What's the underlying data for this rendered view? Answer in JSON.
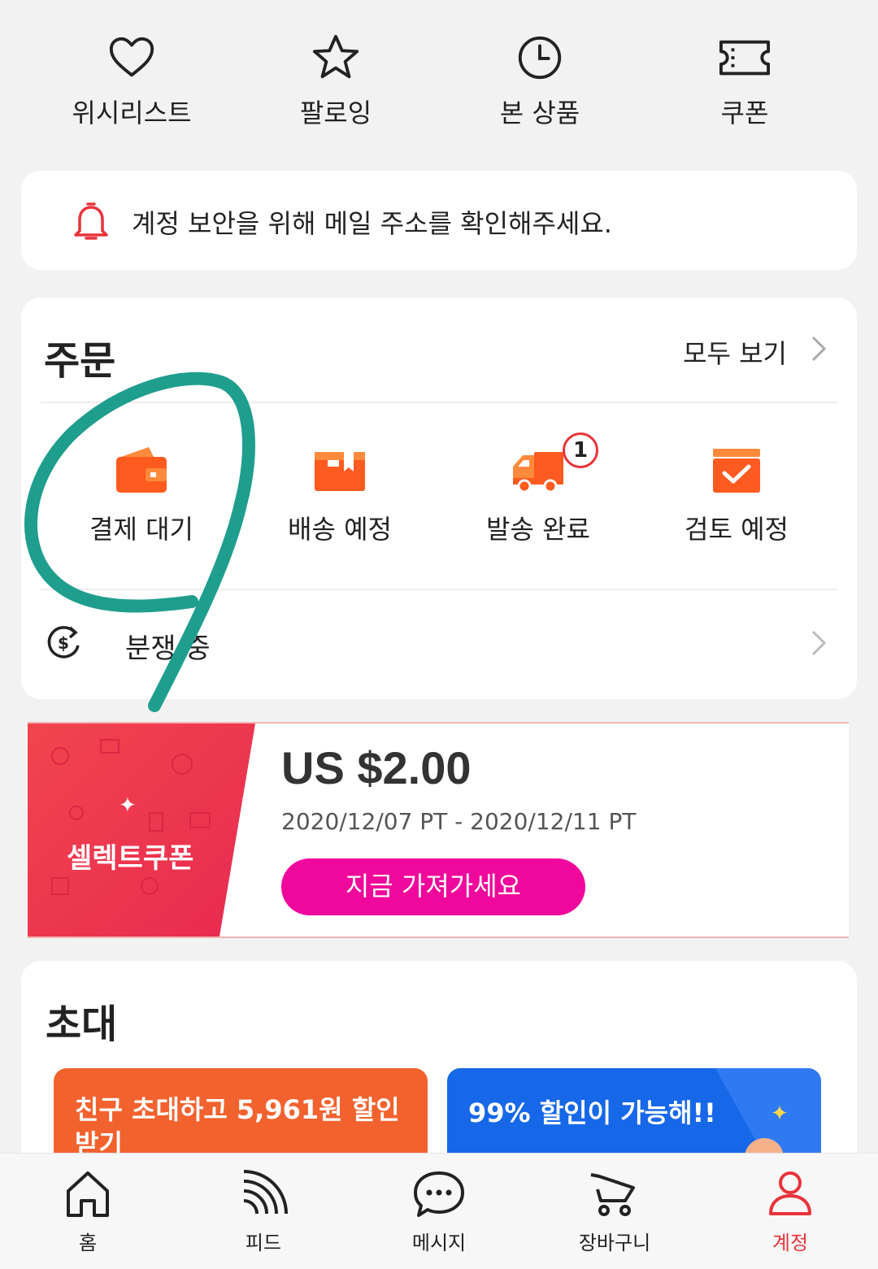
{
  "quick_links": [
    {
      "label": "위시리스트",
      "icon": "heart-icon"
    },
    {
      "label": "팔로잉",
      "icon": "star-icon"
    },
    {
      "label": "본 상품",
      "icon": "clock-icon"
    },
    {
      "label": "쿠폰",
      "icon": "ticket-icon"
    }
  ],
  "notice": {
    "text": "계정 보안을 위해 메일 주소를 확인해주세요.",
    "icon": "bell-icon"
  },
  "orders": {
    "title": "주문",
    "view_all": "모두 보기",
    "statuses": [
      {
        "label": "결제 대기",
        "icon": "wallet-icon"
      },
      {
        "label": "배송 예정",
        "icon": "box-icon"
      },
      {
        "label": "발송 완료",
        "icon": "truck-icon",
        "badge": "1"
      },
      {
        "label": "검토 예정",
        "icon": "review-icon"
      }
    ],
    "dispute": {
      "label": "분쟁 중",
      "icon": "dollar-refresh-icon"
    }
  },
  "coupon": {
    "tag": "셀렉트쿠폰",
    "amount": "US $2.00",
    "dates": "2020/12/07 PT - 2020/12/11 PT",
    "cta": "지금 가져가세요"
  },
  "invite": {
    "title": "초대",
    "banner_left": "친구 초대하고 5,961원 할인 받기",
    "banner_right": "99% 할인이 가능해!!"
  },
  "bottom_nav": [
    {
      "label": "홈",
      "icon": "home-icon"
    },
    {
      "label": "피드",
      "icon": "feed-icon"
    },
    {
      "label": "메시지",
      "icon": "message-icon"
    },
    {
      "label": "장바구니",
      "icon": "cart-icon"
    },
    {
      "label": "계정",
      "icon": "account-icon",
      "active": true
    }
  ],
  "colors": {
    "accent_red": "#e8333a",
    "orange": "#ff5a1f",
    "cta_pink": "#f0079b",
    "scribble_teal": "#1f9e8e",
    "banner_orange": "#f2622e",
    "banner_blue": "#1668e8"
  }
}
